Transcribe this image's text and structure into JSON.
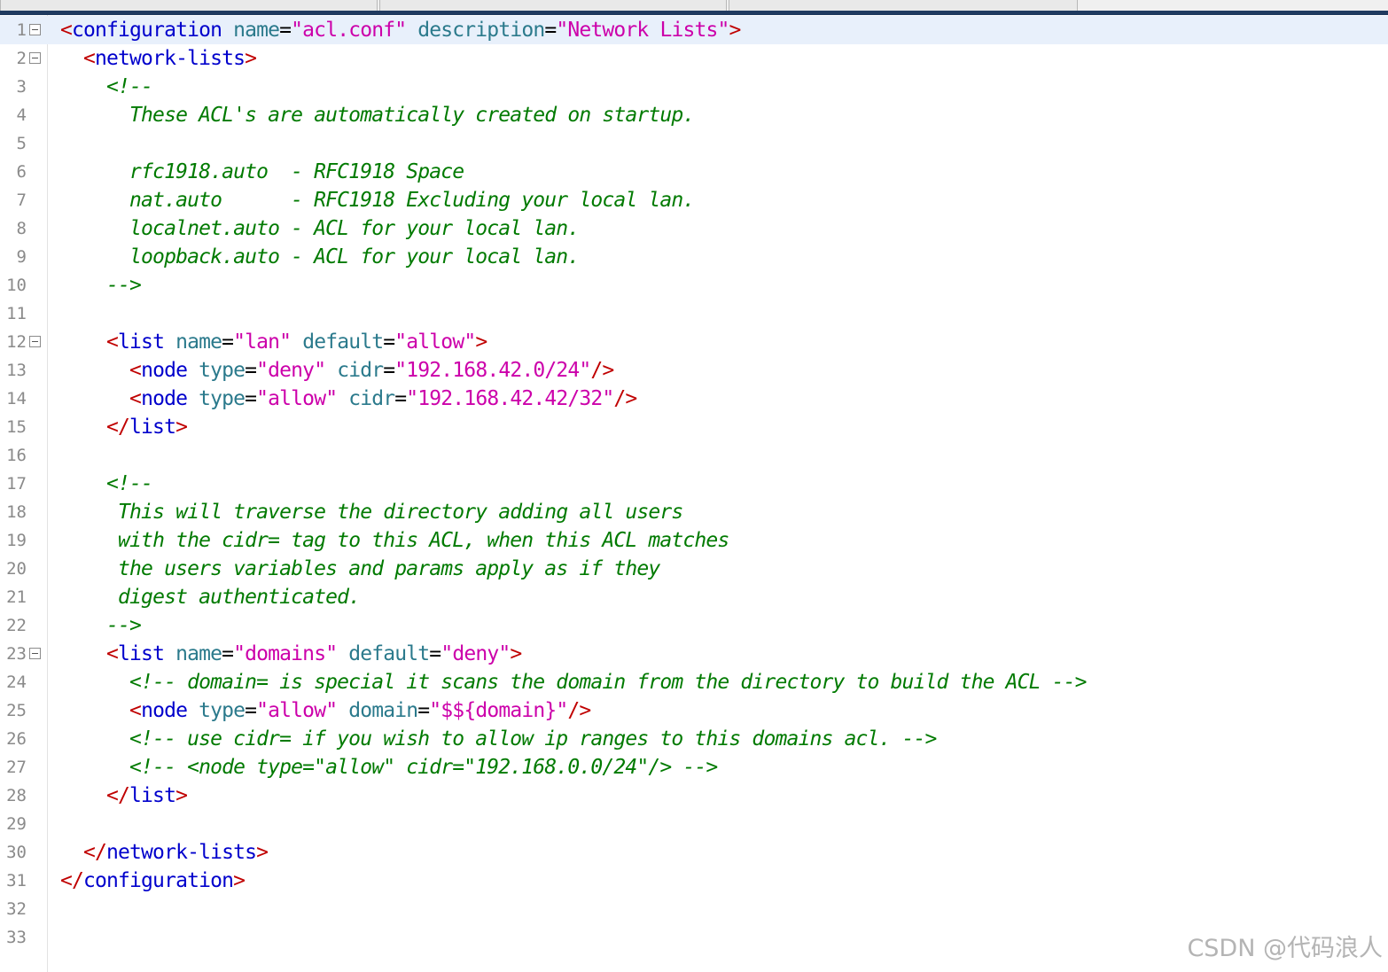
{
  "editor": {
    "current_line": 1,
    "fold_lines": [
      1,
      2,
      12,
      23
    ],
    "lines": [
      [
        [
          "br",
          "<"
        ],
        [
          "tag",
          "configuration"
        ],
        [
          "sp",
          " "
        ],
        [
          "attr",
          "name"
        ],
        [
          "op",
          "="
        ],
        [
          "val",
          "\"acl.conf\""
        ],
        [
          "sp",
          " "
        ],
        [
          "attr",
          "description"
        ],
        [
          "op",
          "="
        ],
        [
          "val",
          "\"Network Lists\""
        ],
        [
          "br",
          ">"
        ]
      ],
      [
        [
          "sp",
          "  "
        ],
        [
          "br",
          "<"
        ],
        [
          "tag",
          "network-lists"
        ],
        [
          "br",
          ">"
        ]
      ],
      [
        [
          "sp",
          "    "
        ],
        [
          "com",
          "<!--"
        ]
      ],
      [
        [
          "sp",
          "      "
        ],
        [
          "com",
          "These ACL's are automatically created on startup."
        ]
      ],
      [],
      [
        [
          "sp",
          "      "
        ],
        [
          "com",
          "rfc1918.auto  - RFC1918 Space"
        ]
      ],
      [
        [
          "sp",
          "      "
        ],
        [
          "com",
          "nat.auto      - RFC1918 Excluding your local lan."
        ]
      ],
      [
        [
          "sp",
          "      "
        ],
        [
          "com",
          "localnet.auto - ACL for your local lan."
        ]
      ],
      [
        [
          "sp",
          "      "
        ],
        [
          "com",
          "loopback.auto - ACL for your local lan."
        ]
      ],
      [
        [
          "sp",
          "    "
        ],
        [
          "com",
          "-->"
        ]
      ],
      [],
      [
        [
          "sp",
          "    "
        ],
        [
          "br",
          "<"
        ],
        [
          "tag",
          "list"
        ],
        [
          "sp",
          " "
        ],
        [
          "attr",
          "name"
        ],
        [
          "op",
          "="
        ],
        [
          "val",
          "\"lan\""
        ],
        [
          "sp",
          " "
        ],
        [
          "attr",
          "default"
        ],
        [
          "op",
          "="
        ],
        [
          "val",
          "\"allow\""
        ],
        [
          "br",
          ">"
        ]
      ],
      [
        [
          "sp",
          "      "
        ],
        [
          "br",
          "<"
        ],
        [
          "tag",
          "node"
        ],
        [
          "sp",
          " "
        ],
        [
          "attr",
          "type"
        ],
        [
          "op",
          "="
        ],
        [
          "val",
          "\"deny\""
        ],
        [
          "sp",
          " "
        ],
        [
          "attr",
          "cidr"
        ],
        [
          "op",
          "="
        ],
        [
          "val",
          "\"192.168.42.0/24\""
        ],
        [
          "br",
          "/>"
        ]
      ],
      [
        [
          "sp",
          "      "
        ],
        [
          "br",
          "<"
        ],
        [
          "tag",
          "node"
        ],
        [
          "sp",
          " "
        ],
        [
          "attr",
          "type"
        ],
        [
          "op",
          "="
        ],
        [
          "val",
          "\"allow\""
        ],
        [
          "sp",
          " "
        ],
        [
          "attr",
          "cidr"
        ],
        [
          "op",
          "="
        ],
        [
          "val",
          "\"192.168.42.42/32\""
        ],
        [
          "br",
          "/>"
        ]
      ],
      [
        [
          "sp",
          "    "
        ],
        [
          "br",
          "</"
        ],
        [
          "tag",
          "list"
        ],
        [
          "br",
          ">"
        ]
      ],
      [],
      [
        [
          "sp",
          "    "
        ],
        [
          "com",
          "<!--"
        ]
      ],
      [
        [
          "sp",
          "     "
        ],
        [
          "com",
          "This will traverse the directory adding all users"
        ]
      ],
      [
        [
          "sp",
          "     "
        ],
        [
          "com",
          "with the cidr= tag to this ACL, when this ACL matches"
        ]
      ],
      [
        [
          "sp",
          "     "
        ],
        [
          "com",
          "the users variables and params apply as if they"
        ]
      ],
      [
        [
          "sp",
          "     "
        ],
        [
          "com",
          "digest authenticated."
        ]
      ],
      [
        [
          "sp",
          "    "
        ],
        [
          "com",
          "-->"
        ]
      ],
      [
        [
          "sp",
          "    "
        ],
        [
          "br",
          "<"
        ],
        [
          "tag",
          "list"
        ],
        [
          "sp",
          " "
        ],
        [
          "attr",
          "name"
        ],
        [
          "op",
          "="
        ],
        [
          "val",
          "\"domains\""
        ],
        [
          "sp",
          " "
        ],
        [
          "attr",
          "default"
        ],
        [
          "op",
          "="
        ],
        [
          "val",
          "\"deny\""
        ],
        [
          "br",
          ">"
        ]
      ],
      [
        [
          "sp",
          "      "
        ],
        [
          "com",
          "<!-- domain= is special it scans the domain from the directory to build the ACL -->"
        ]
      ],
      [
        [
          "sp",
          "      "
        ],
        [
          "br",
          "<"
        ],
        [
          "tag",
          "node"
        ],
        [
          "sp",
          " "
        ],
        [
          "attr",
          "type"
        ],
        [
          "op",
          "="
        ],
        [
          "val",
          "\"allow\""
        ],
        [
          "sp",
          " "
        ],
        [
          "attr",
          "domain"
        ],
        [
          "op",
          "="
        ],
        [
          "val",
          "\"$${domain}\""
        ],
        [
          "br",
          "/>"
        ]
      ],
      [
        [
          "sp",
          "      "
        ],
        [
          "com",
          "<!-- use cidr= if you wish to allow ip ranges to this domains acl. -->"
        ]
      ],
      [
        [
          "sp",
          "      "
        ],
        [
          "com",
          "<!-- <node type=\"allow\" cidr=\"192.168.0.0/24\"/> -->"
        ]
      ],
      [
        [
          "sp",
          "    "
        ],
        [
          "br",
          "</"
        ],
        [
          "tag",
          "list"
        ],
        [
          "br",
          ">"
        ]
      ],
      [],
      [
        [
          "sp",
          "  "
        ],
        [
          "br",
          "</"
        ],
        [
          "tag",
          "network-lists"
        ],
        [
          "br",
          ">"
        ]
      ],
      [
        [
          "br",
          "</"
        ],
        [
          "tag",
          "configuration"
        ],
        [
          "br",
          ">"
        ]
      ],
      [],
      []
    ]
  },
  "watermark": "CSDN @代码浪人"
}
